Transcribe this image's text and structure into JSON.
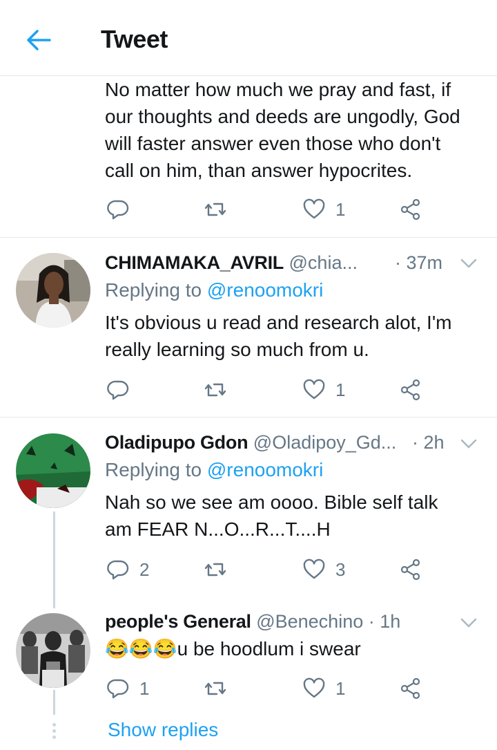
{
  "header": {
    "title": "Tweet",
    "back_icon": "arrow-left-icon"
  },
  "colors": {
    "accent": "#1da1f2",
    "muted": "#657786",
    "border": "#e1e8ed"
  },
  "main_tweet": {
    "lines": [
      "No matter how much we pray and fast, if",
      "our thoughts and deeds are ungodly, God",
      "will faster answer even those who don't",
      "call on him, than answer hypocrites."
    ],
    "replies": "",
    "likes": "1"
  },
  "replies": [
    {
      "name": "CHIMAMAKA_AVRIL",
      "handle": "@chia...",
      "time": "· 37m",
      "replying_prefix": "Replying to ",
      "replying_to": "@renoomokri",
      "lines": [
        "It's obvious u read and research alot, I'm",
        "really learning so much from u."
      ],
      "replies": "",
      "likes": "1"
    },
    {
      "name": "Oladipupo Gdon",
      "handle": "@Oladipoy_Gd...",
      "time": "· 2h",
      "replying_prefix": "Replying to ",
      "replying_to": "@renoomokri",
      "lines": [
        "Nah so we see am oooo. Bible self talk",
        "am FEAR N...O...R...T....H"
      ],
      "replies": "2",
      "likes": "3"
    },
    {
      "name": "people's General",
      "handle": "@Benechino",
      "time": "· 1h",
      "lines": [
        "😂😂😂u be hoodlum i swear"
      ],
      "replies": "1",
      "likes": "1"
    }
  ],
  "show_replies": "Show replies"
}
